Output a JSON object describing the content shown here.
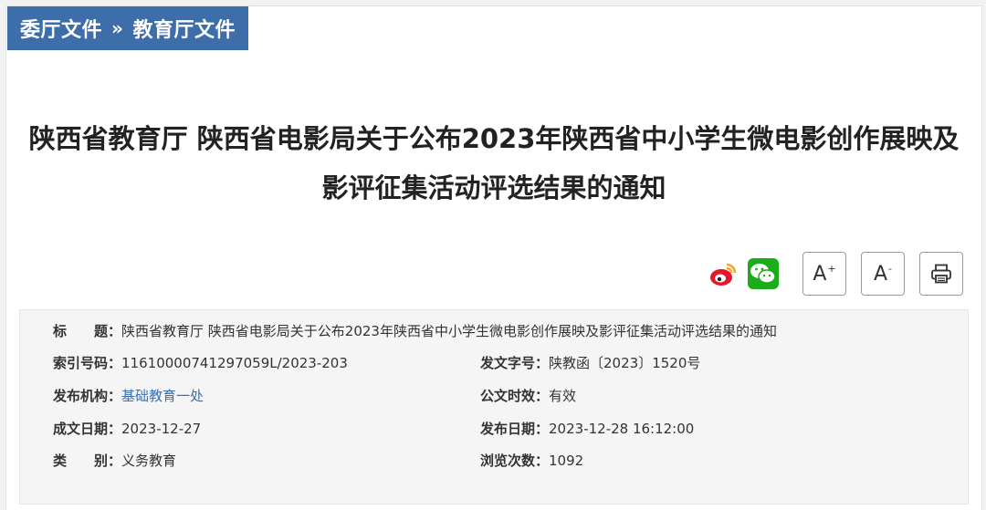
{
  "breadcrumb": {
    "item1": "委厅文件",
    "separator": "»",
    "item2": "教育厅文件"
  },
  "title": {
    "line1": "陕西省教育厅 陕西省电影局关于公布2023年陕西省中小学生微电影创作展映及",
    "line2": "影评征集活动评选结果的通知"
  },
  "tools": {
    "font_increase": "A",
    "font_increase_sup": "+",
    "font_decrease": "A",
    "font_decrease_sup": "-",
    "share_icons": [
      "weibo-icon",
      "wechat-icon"
    ],
    "print_icon": "printer-icon"
  },
  "meta": {
    "title_label": "标　　题：",
    "title_value": "陕西省教育厅 陕西省电影局关于公布2023年陕西省中小学生微电影创作展映及影评征集活动评选结果的通知",
    "index_label": "索引号码：",
    "index_value": "11610000741297059L/2023-203",
    "docno_label": "发文字号：",
    "docno_value": "陕教函〔2023〕1520号",
    "org_label": "发布机构：",
    "org_value": "基础教育一处",
    "validity_label": "公文时效：",
    "validity_value": "有效",
    "created_label": "成文日期：",
    "created_value": "2023-12-27",
    "published_label": "发布日期：",
    "published_value": "2023-12-28 16:12:00",
    "category_label": "类　　别：",
    "category_value": "义务教育",
    "views_label": "浏览次数：",
    "views_value": "1092"
  },
  "colors": {
    "breadcrumb_bg": "#3d6eaa",
    "link": "#3a6fb5",
    "weibo": "#e6162d",
    "wechat": "#1aad19"
  }
}
